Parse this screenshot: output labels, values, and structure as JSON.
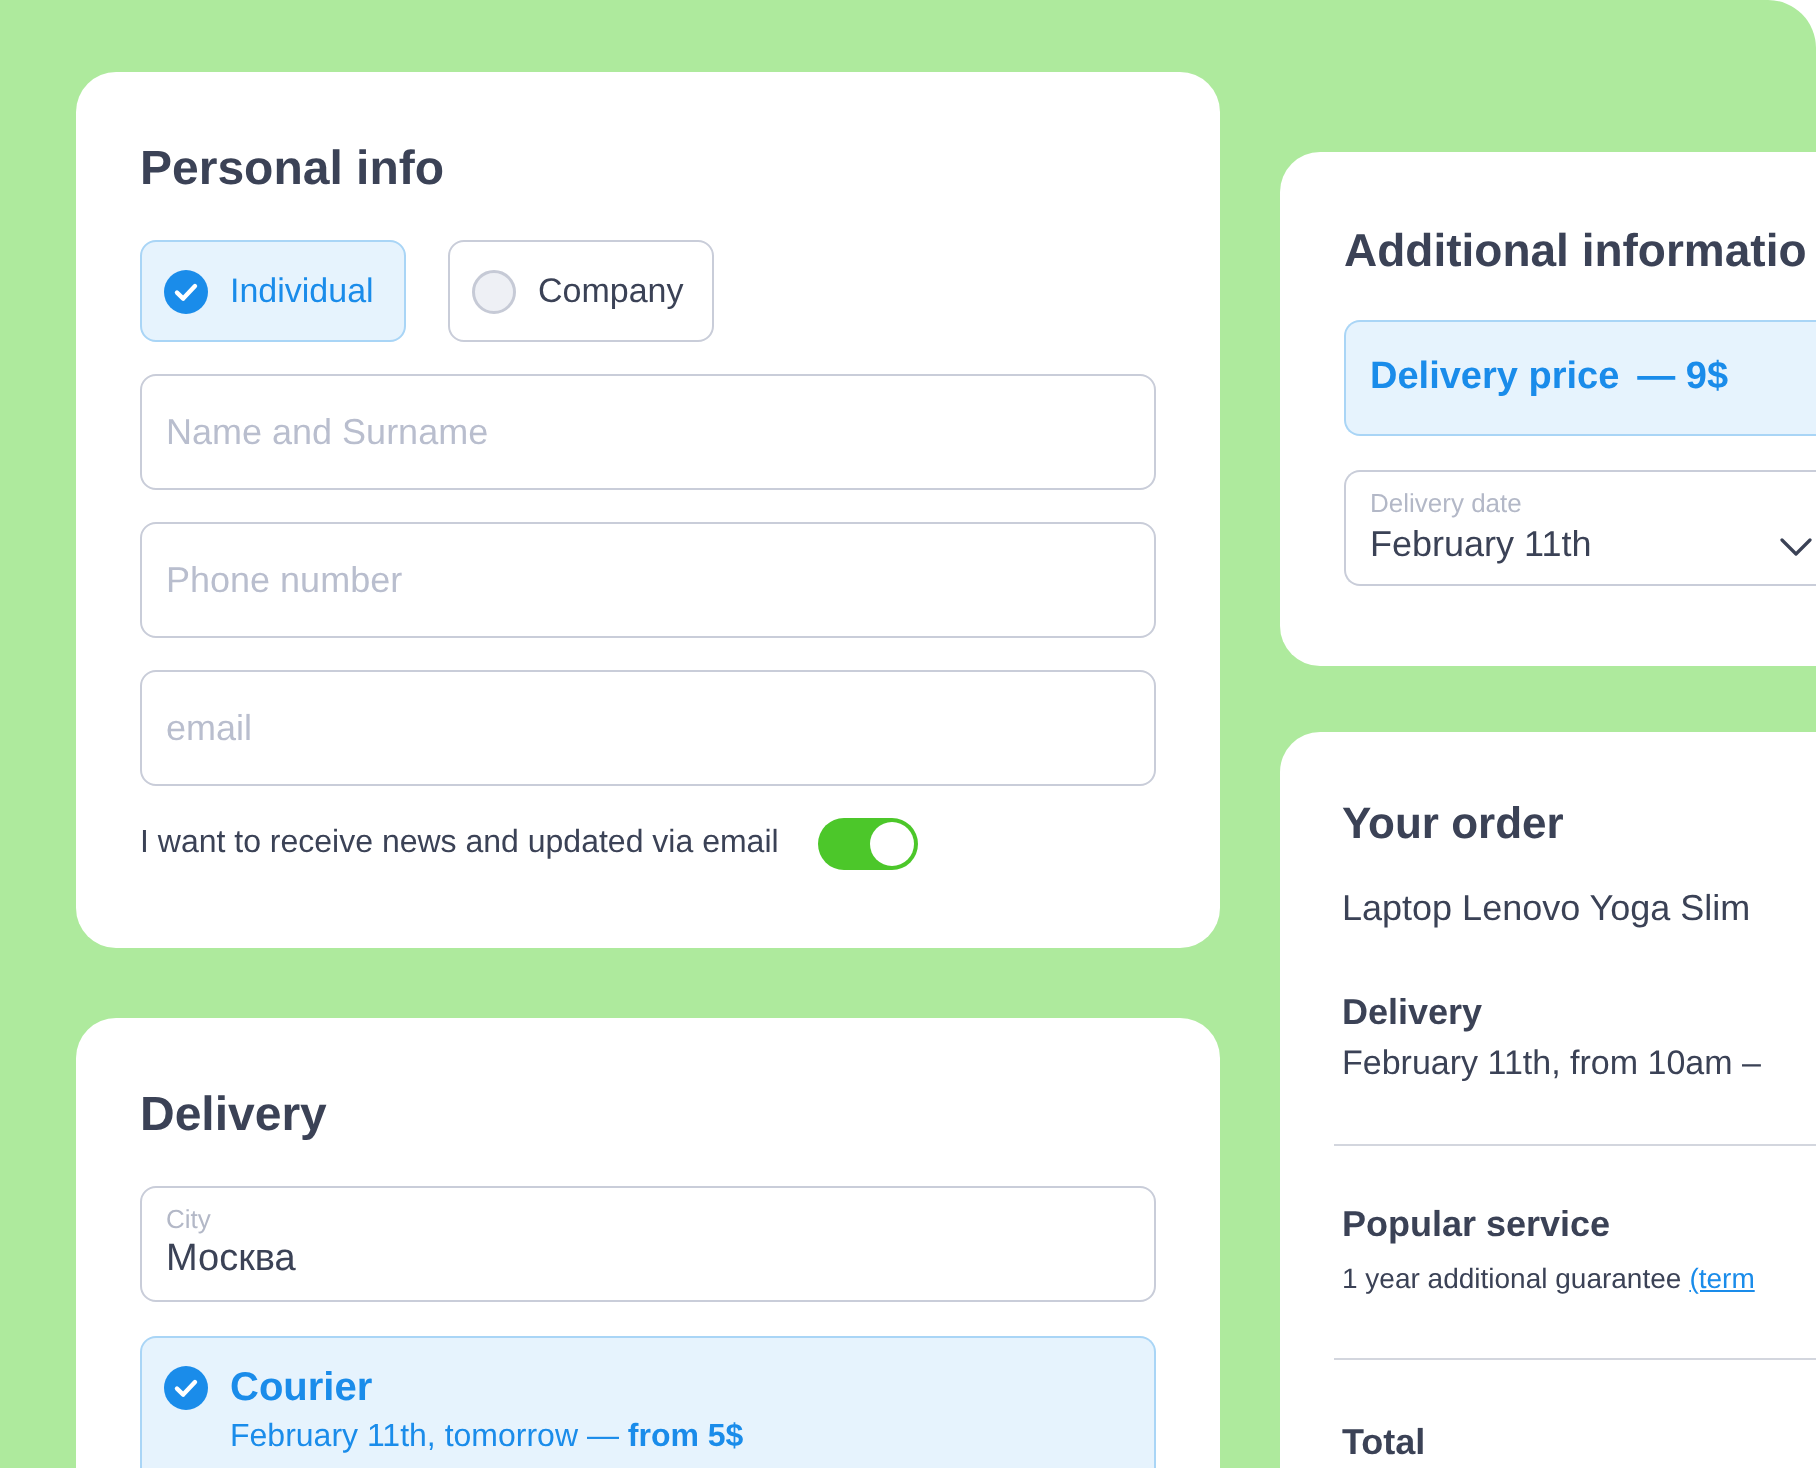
{
  "personal_info": {
    "title": "Personal info",
    "customer_types": [
      {
        "label": "Individual",
        "selected": true
      },
      {
        "label": "Company",
        "selected": false
      }
    ],
    "fields": [
      {
        "placeholder": "Name and Surname"
      },
      {
        "placeholder": "Phone number"
      },
      {
        "placeholder": "email"
      }
    ],
    "newsletter": {
      "label": "I want to receive news and updated via email",
      "on": true
    }
  },
  "delivery": {
    "title": "Delivery",
    "city": {
      "label": "City",
      "value": "Москва"
    },
    "methods": [
      {
        "name": "Courier",
        "detail": "February 11th, tomorrow — **from 5$**",
        "selected": true
      }
    ]
  },
  "additional_information": {
    "title": "Additional informatio",
    "delivery_price": {
      "label": "Delivery price",
      "value": "— 9$"
    },
    "delivery_date": {
      "label": "Delivery date",
      "value": "February 11th"
    }
  },
  "order": {
    "title": "Your order",
    "product": "Laptop Lenovo Yoga Slim",
    "sections": [
      {
        "heading": "Delivery",
        "text": "February 11th, from 10am –"
      },
      {
        "heading": "Popular service",
        "text": "1 year additional guarantee",
        "link": "(term"
      },
      {
        "heading": "Total"
      }
    ]
  }
}
